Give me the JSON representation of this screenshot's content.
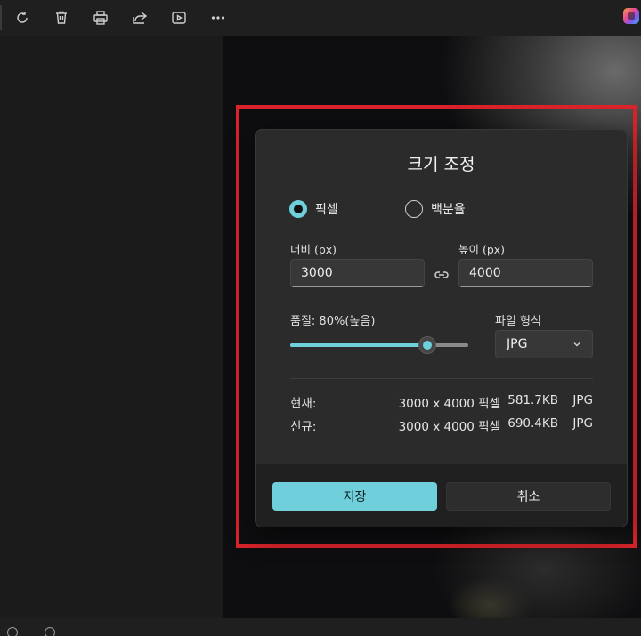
{
  "dialog": {
    "title": "크기 조정",
    "radio_pixels": "픽셀",
    "radio_percent": "백분율",
    "width_label": "너비 (px)",
    "width_value": "3000",
    "height_label": "높이 (px)",
    "height_value": "4000",
    "quality_label": "품질: 80%(높음)",
    "quality_value": 0.8,
    "format_label": "파일 형식",
    "format_value": "JPG",
    "current": {
      "label": "현재:",
      "dimensions": "3000 x 4000 픽셀",
      "size": "581.7KB",
      "format": "JPG"
    },
    "new": {
      "label": "신규:",
      "dimensions": "3000 x 4000 픽셀",
      "size": "690.4KB",
      "format": "JPG"
    },
    "save_label": "저장",
    "cancel_label": "취소"
  },
  "colors": {
    "accent": "#6fd0dc",
    "highlight": "#d8232a"
  },
  "toolbar": {
    "icons": [
      "rotate-icon",
      "delete-icon",
      "print-icon",
      "share-icon",
      "slideshow-icon",
      "more-icon",
      "copilot-icon"
    ]
  }
}
